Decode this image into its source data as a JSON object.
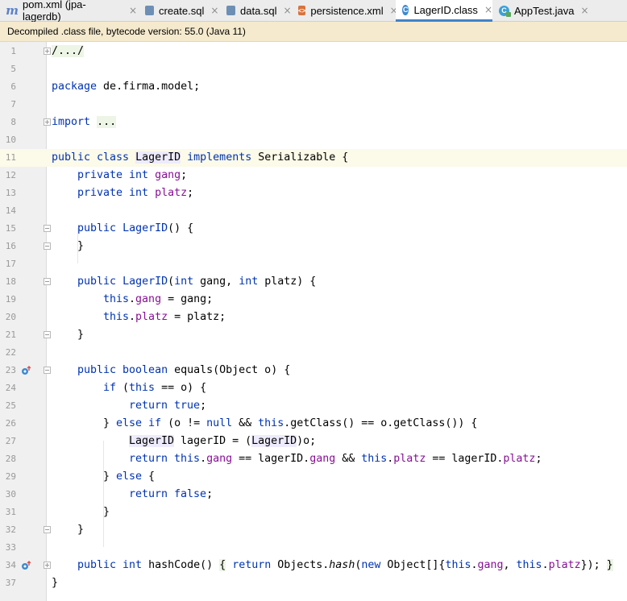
{
  "tabs": [
    {
      "label": "pom.xml (jpa-lagerdb)",
      "icon": "maven-icon"
    },
    {
      "label": "create.sql",
      "icon": "sql-file-icon"
    },
    {
      "label": "data.sql",
      "icon": "sql-file-icon"
    },
    {
      "label": "persistence.xml",
      "icon": "xml-file-icon"
    },
    {
      "label": "LagerID.class",
      "icon": "class-file-icon"
    },
    {
      "label": "AppTest.java",
      "icon": "test-class-icon"
    }
  ],
  "banner": "Decompiled .class file, bytecode version: 55.0 (Java 11)",
  "lines": [
    {
      "n": "1"
    },
    {
      "n": "5"
    },
    {
      "n": "6"
    },
    {
      "n": "7"
    },
    {
      "n": "8"
    },
    {
      "n": "10"
    },
    {
      "n": "11"
    },
    {
      "n": "12"
    },
    {
      "n": "13"
    },
    {
      "n": "14"
    },
    {
      "n": "15"
    },
    {
      "n": "16"
    },
    {
      "n": "17"
    },
    {
      "n": "18"
    },
    {
      "n": "19"
    },
    {
      "n": "20"
    },
    {
      "n": "21"
    },
    {
      "n": "22"
    },
    {
      "n": "23"
    },
    {
      "n": "24"
    },
    {
      "n": "25"
    },
    {
      "n": "26"
    },
    {
      "n": "27"
    },
    {
      "n": "28"
    },
    {
      "n": "29"
    },
    {
      "n": "30"
    },
    {
      "n": "31"
    },
    {
      "n": "32"
    },
    {
      "n": "33"
    },
    {
      "n": "34"
    },
    {
      "n": "37"
    }
  ],
  "code": {
    "l1": {
      "a": "/.../"
    },
    "l6": {
      "a": "package",
      "b": " de.firma.model;"
    },
    "l8": {
      "a": "import",
      "b": " ",
      "c": "..."
    },
    "l11": {
      "a": "public class",
      "b": " ",
      "c": "LagerID",
      "d": " ",
      "e": "implements",
      "f": " Serializable {"
    },
    "l12": {
      "a": "private int",
      "b": " ",
      "c": "gang",
      "d": ";"
    },
    "l13": {
      "a": "private int",
      "b": " ",
      "c": "platz",
      "d": ";"
    },
    "l15": {
      "a": "public",
      "b": " ",
      "c": "LagerID",
      "d": "() {"
    },
    "l16": {
      "a": "}"
    },
    "l18": {
      "a": "public",
      "b": " ",
      "c": "LagerID",
      "d": "(",
      "e": "int",
      "f": " gang, ",
      "g": "int",
      "h": " platz) {"
    },
    "l19": {
      "a": "this",
      "b": ".",
      "c": "gang",
      "d": " = gang;"
    },
    "l20": {
      "a": "this",
      "b": ".",
      "c": "platz",
      "d": " = platz;"
    },
    "l21": {
      "a": "}"
    },
    "l23": {
      "a": "public boolean",
      "b": " ",
      "c": "equals",
      "d": "(Object o) {"
    },
    "l24": {
      "a": "if",
      "b": " (",
      "c": "this",
      "d": " == o) {"
    },
    "l25": {
      "a": "return true",
      "b": ";"
    },
    "l26": {
      "a": "} ",
      "b": "else if",
      "c": " (o != ",
      "d": "null",
      "e": " && ",
      "f": "this",
      "g": ".getClass() == o.getClass()) {"
    },
    "l27": {
      "a": "LagerID",
      "b": " lagerID = (",
      "c": "LagerID",
      "d": ")o;"
    },
    "l28": {
      "a": "return this",
      "b": ".",
      "c": "gang",
      "d": " == lagerID.",
      "e": "gang",
      "f": " && ",
      "g": "this",
      "h": ".",
      "i": "platz",
      "j": " == lagerID.",
      "k": "platz",
      "l": ";"
    },
    "l29": {
      "a": "} ",
      "b": "else",
      "c": " {"
    },
    "l30": {
      "a": "return false",
      "b": ";"
    },
    "l31": {
      "a": "}"
    },
    "l32": {
      "a": "}"
    },
    "l34": {
      "a": "public int",
      "b": " ",
      "c": "hashCode",
      "d": "()",
      "e": " ",
      "f": "{",
      "g": " ",
      "h": "return",
      "i": " Objects.",
      "j": "hash",
      "k": "(",
      "l": "new",
      "m": " Object[]{",
      "n": "this",
      "o": ".",
      "p": "gang",
      "q": ", ",
      "r": "this",
      "s": ".",
      "t": "platz",
      "u": "});",
      "v": " ",
      "w": "}"
    },
    "l37": {
      "a": "}"
    }
  },
  "colors": {
    "keyword": "#0033b3",
    "field": "#871094",
    "tab_accent": "#4083c9",
    "banner_bg": "#f5eacd"
  }
}
